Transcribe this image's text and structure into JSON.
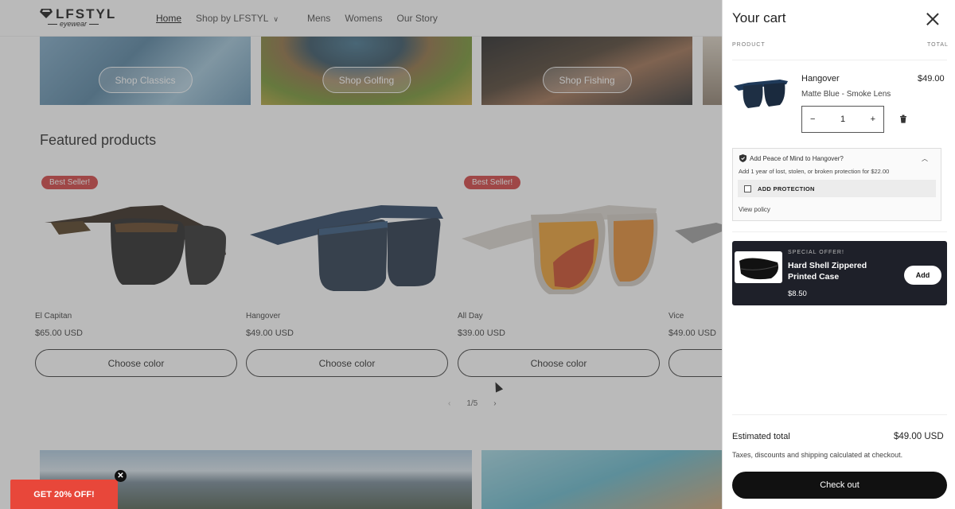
{
  "header": {
    "logo_text": "LFSTYL",
    "logo_sub": "eyewear",
    "nav": [
      "Home",
      "Shop by LFSTYL",
      "Mens",
      "Womens",
      "Our Story"
    ]
  },
  "categories": [
    "Shop Classics",
    "Shop Golfing",
    "Shop Fishing"
  ],
  "featured": {
    "title": "Featured products",
    "products": [
      {
        "name": "El Capitan",
        "price": "$65.00 USD",
        "badge": "Best Seller!",
        "button": "Choose color"
      },
      {
        "name": "Hangover",
        "price": "$49.00 USD",
        "badge": "",
        "button": "Choose color"
      },
      {
        "name": "All Day",
        "price": "$39.00 USD",
        "badge": "Best Seller!",
        "button": "Choose color"
      },
      {
        "name": "Vice",
        "price": "$49.00 USD",
        "badge": "",
        "button": "Choose color"
      }
    ],
    "pager": "1/5"
  },
  "promo": {
    "label": "GET 20% OFF!"
  },
  "cart": {
    "title": "Your cart",
    "col_product": "PRODUCT",
    "col_total": "TOTAL",
    "item": {
      "name": "Hangover",
      "price": "$49.00",
      "variant": "Matte Blue - Smoke Lens",
      "qty": "1"
    },
    "protection": {
      "title": "Add Peace of Mind to Hangover?",
      "desc": "Add 1 year of lost, stolen, or broken protection for $22.00",
      "checkbox_label": "ADD PROTECTION",
      "policy": "View policy"
    },
    "offer": {
      "tag": "SPECIAL OFFER!",
      "name": "Hard Shell Zippered Printed Case",
      "price": "$8.50",
      "button": "Add"
    },
    "estimated_label": "Estimated total",
    "estimated_value": "$49.00 USD",
    "tax_note": "Taxes, discounts and shipping calculated at checkout.",
    "checkout": "Check out"
  },
  "colors": {
    "accent_red": "#d13a3a",
    "promo_red": "#e8473a",
    "dark": "#1e2029"
  }
}
